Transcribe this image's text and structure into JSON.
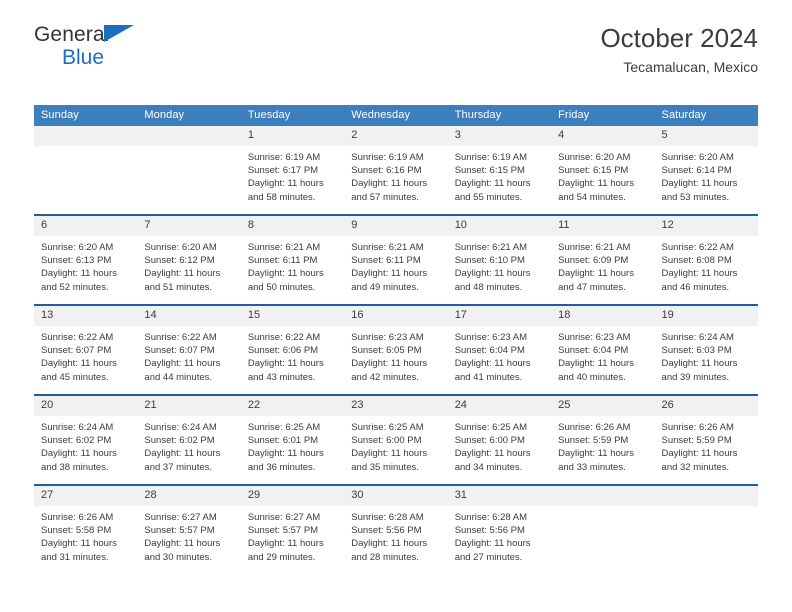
{
  "brand": {
    "word1": "General",
    "word2": "Blue",
    "flag_color": "#1b6ec2"
  },
  "header": {
    "title": "October 2024",
    "subtitle": "Tecamalucan, Mexico"
  },
  "theme": {
    "header_bg": "#3d7ebd",
    "row_divider": "#1f5fa0",
    "daynum_bg": "#f1f1f1",
    "text": "#3c3c3c"
  },
  "weekday_headers": [
    "Sunday",
    "Monday",
    "Tuesday",
    "Wednesday",
    "Thursday",
    "Friday",
    "Saturday"
  ],
  "weeks": [
    [
      {
        "day": "",
        "sunrise": "",
        "sunset": "",
        "daylight1": "",
        "daylight2": "",
        "empty": true
      },
      {
        "day": "",
        "sunrise": "",
        "sunset": "",
        "daylight1": "",
        "daylight2": "",
        "empty": true
      },
      {
        "day": "1",
        "sunrise": "Sunrise: 6:19 AM",
        "sunset": "Sunset: 6:17 PM",
        "daylight1": "Daylight: 11 hours",
        "daylight2": "and 58 minutes."
      },
      {
        "day": "2",
        "sunrise": "Sunrise: 6:19 AM",
        "sunset": "Sunset: 6:16 PM",
        "daylight1": "Daylight: 11 hours",
        "daylight2": "and 57 minutes."
      },
      {
        "day": "3",
        "sunrise": "Sunrise: 6:19 AM",
        "sunset": "Sunset: 6:15 PM",
        "daylight1": "Daylight: 11 hours",
        "daylight2": "and 55 minutes."
      },
      {
        "day": "4",
        "sunrise": "Sunrise: 6:20 AM",
        "sunset": "Sunset: 6:15 PM",
        "daylight1": "Daylight: 11 hours",
        "daylight2": "and 54 minutes."
      },
      {
        "day": "5",
        "sunrise": "Sunrise: 6:20 AM",
        "sunset": "Sunset: 6:14 PM",
        "daylight1": "Daylight: 11 hours",
        "daylight2": "and 53 minutes."
      }
    ],
    [
      {
        "day": "6",
        "sunrise": "Sunrise: 6:20 AM",
        "sunset": "Sunset: 6:13 PM",
        "daylight1": "Daylight: 11 hours",
        "daylight2": "and 52 minutes."
      },
      {
        "day": "7",
        "sunrise": "Sunrise: 6:20 AM",
        "sunset": "Sunset: 6:12 PM",
        "daylight1": "Daylight: 11 hours",
        "daylight2": "and 51 minutes."
      },
      {
        "day": "8",
        "sunrise": "Sunrise: 6:21 AM",
        "sunset": "Sunset: 6:11 PM",
        "daylight1": "Daylight: 11 hours",
        "daylight2": "and 50 minutes."
      },
      {
        "day": "9",
        "sunrise": "Sunrise: 6:21 AM",
        "sunset": "Sunset: 6:11 PM",
        "daylight1": "Daylight: 11 hours",
        "daylight2": "and 49 minutes."
      },
      {
        "day": "10",
        "sunrise": "Sunrise: 6:21 AM",
        "sunset": "Sunset: 6:10 PM",
        "daylight1": "Daylight: 11 hours",
        "daylight2": "and 48 minutes."
      },
      {
        "day": "11",
        "sunrise": "Sunrise: 6:21 AM",
        "sunset": "Sunset: 6:09 PM",
        "daylight1": "Daylight: 11 hours",
        "daylight2": "and 47 minutes."
      },
      {
        "day": "12",
        "sunrise": "Sunrise: 6:22 AM",
        "sunset": "Sunset: 6:08 PM",
        "daylight1": "Daylight: 11 hours",
        "daylight2": "and 46 minutes."
      }
    ],
    [
      {
        "day": "13",
        "sunrise": "Sunrise: 6:22 AM",
        "sunset": "Sunset: 6:07 PM",
        "daylight1": "Daylight: 11 hours",
        "daylight2": "and 45 minutes."
      },
      {
        "day": "14",
        "sunrise": "Sunrise: 6:22 AM",
        "sunset": "Sunset: 6:07 PM",
        "daylight1": "Daylight: 11 hours",
        "daylight2": "and 44 minutes."
      },
      {
        "day": "15",
        "sunrise": "Sunrise: 6:22 AM",
        "sunset": "Sunset: 6:06 PM",
        "daylight1": "Daylight: 11 hours",
        "daylight2": "and 43 minutes."
      },
      {
        "day": "16",
        "sunrise": "Sunrise: 6:23 AM",
        "sunset": "Sunset: 6:05 PM",
        "daylight1": "Daylight: 11 hours",
        "daylight2": "and 42 minutes."
      },
      {
        "day": "17",
        "sunrise": "Sunrise: 6:23 AM",
        "sunset": "Sunset: 6:04 PM",
        "daylight1": "Daylight: 11 hours",
        "daylight2": "and 41 minutes."
      },
      {
        "day": "18",
        "sunrise": "Sunrise: 6:23 AM",
        "sunset": "Sunset: 6:04 PM",
        "daylight1": "Daylight: 11 hours",
        "daylight2": "and 40 minutes."
      },
      {
        "day": "19",
        "sunrise": "Sunrise: 6:24 AM",
        "sunset": "Sunset: 6:03 PM",
        "daylight1": "Daylight: 11 hours",
        "daylight2": "and 39 minutes."
      }
    ],
    [
      {
        "day": "20",
        "sunrise": "Sunrise: 6:24 AM",
        "sunset": "Sunset: 6:02 PM",
        "daylight1": "Daylight: 11 hours",
        "daylight2": "and 38 minutes."
      },
      {
        "day": "21",
        "sunrise": "Sunrise: 6:24 AM",
        "sunset": "Sunset: 6:02 PM",
        "daylight1": "Daylight: 11 hours",
        "daylight2": "and 37 minutes."
      },
      {
        "day": "22",
        "sunrise": "Sunrise: 6:25 AM",
        "sunset": "Sunset: 6:01 PM",
        "daylight1": "Daylight: 11 hours",
        "daylight2": "and 36 minutes."
      },
      {
        "day": "23",
        "sunrise": "Sunrise: 6:25 AM",
        "sunset": "Sunset: 6:00 PM",
        "daylight1": "Daylight: 11 hours",
        "daylight2": "and 35 minutes."
      },
      {
        "day": "24",
        "sunrise": "Sunrise: 6:25 AM",
        "sunset": "Sunset: 6:00 PM",
        "daylight1": "Daylight: 11 hours",
        "daylight2": "and 34 minutes."
      },
      {
        "day": "25",
        "sunrise": "Sunrise: 6:26 AM",
        "sunset": "Sunset: 5:59 PM",
        "daylight1": "Daylight: 11 hours",
        "daylight2": "and 33 minutes."
      },
      {
        "day": "26",
        "sunrise": "Sunrise: 6:26 AM",
        "sunset": "Sunset: 5:59 PM",
        "daylight1": "Daylight: 11 hours",
        "daylight2": "and 32 minutes."
      }
    ],
    [
      {
        "day": "27",
        "sunrise": "Sunrise: 6:26 AM",
        "sunset": "Sunset: 5:58 PM",
        "daylight1": "Daylight: 11 hours",
        "daylight2": "and 31 minutes."
      },
      {
        "day": "28",
        "sunrise": "Sunrise: 6:27 AM",
        "sunset": "Sunset: 5:57 PM",
        "daylight1": "Daylight: 11 hours",
        "daylight2": "and 30 minutes."
      },
      {
        "day": "29",
        "sunrise": "Sunrise: 6:27 AM",
        "sunset": "Sunset: 5:57 PM",
        "daylight1": "Daylight: 11 hours",
        "daylight2": "and 29 minutes."
      },
      {
        "day": "30",
        "sunrise": "Sunrise: 6:28 AM",
        "sunset": "Sunset: 5:56 PM",
        "daylight1": "Daylight: 11 hours",
        "daylight2": "and 28 minutes."
      },
      {
        "day": "31",
        "sunrise": "Sunrise: 6:28 AM",
        "sunset": "Sunset: 5:56 PM",
        "daylight1": "Daylight: 11 hours",
        "daylight2": "and 27 minutes."
      },
      {
        "day": "",
        "sunrise": "",
        "sunset": "",
        "daylight1": "",
        "daylight2": "",
        "empty": true
      },
      {
        "day": "",
        "sunrise": "",
        "sunset": "",
        "daylight1": "",
        "daylight2": "",
        "empty": true
      }
    ]
  ]
}
